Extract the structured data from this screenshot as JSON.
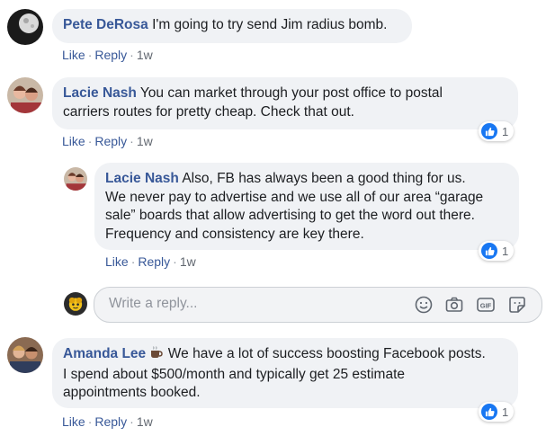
{
  "comments": [
    {
      "author": "Pete DeRosa",
      "text": "I'm going to try send Jim radius bomb.",
      "actions": {
        "like": "Like",
        "reply": "Reply",
        "time": "1w"
      }
    },
    {
      "author": "Lacie Nash",
      "text_line1": "You can market through your post office to postal",
      "text_line2": "carriers routes for pretty cheap. Check that out.",
      "actions": {
        "like": "Like",
        "reply": "Reply",
        "time": "1w"
      },
      "reaction_count": "1",
      "replies": [
        {
          "author": "Lacie Nash",
          "text_line1": "Also, FB has always been a good thing for us.",
          "text_line2": "We never pay to advertise and we use all of our area “garage",
          "text_line3": "sale” boards that allow advertising to get the word out there.",
          "text_line4": "Frequency and consistency are key there.",
          "actions": {
            "like": "Like",
            "reply": "Reply",
            "time": "1w"
          },
          "reaction_count": "1"
        }
      ]
    },
    {
      "author": "Amanda Lee",
      "author_icon": "coffee-icon",
      "text_line1": "We have a lot of success boosting Facebook posts.",
      "text_line2": "I spend about $500/month and typically get 25 estimate",
      "text_line3": "appointments booked.",
      "actions": {
        "like": "Like",
        "reply": "Reply",
        "time": "1w"
      },
      "reaction_count": "1"
    }
  ],
  "reply_input": {
    "placeholder": "Write a reply...",
    "tools": [
      "emoji-icon",
      "camera-icon",
      "gif-icon",
      "sticker-icon"
    ]
  },
  "colors": {
    "name_link": "#385898",
    "bubble_bg": "#f0f2f5",
    "like_blue": "#1877f2",
    "meta_gray": "#616770"
  }
}
